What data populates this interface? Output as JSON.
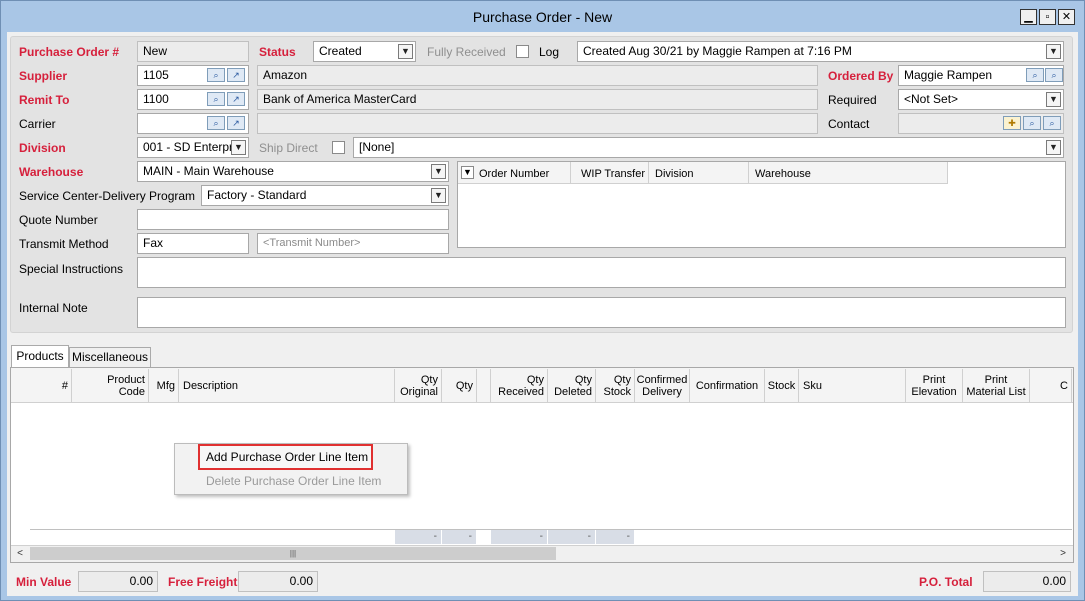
{
  "window": {
    "title": "Purchase Order - New",
    "minimize_glyph": "▁",
    "maximize_glyph": "▫",
    "close_glyph": "✕"
  },
  "header": {
    "po_label": "Purchase Order #",
    "po_value": "New",
    "status_label": "Status",
    "status_value": "Created",
    "fully_received_label": "Fully Received",
    "log_label": "Log",
    "log_value": "Created Aug 30/21 by Maggie Rampen at 7:16 PM",
    "supplier_label": "Supplier",
    "supplier_code": "1105",
    "supplier_name": "Amazon",
    "ordered_by_label": "Ordered By",
    "ordered_by_value": "Maggie Rampen",
    "remit_label": "Remit To",
    "remit_code": "1100",
    "remit_name": "Bank of America MasterCard",
    "required_label": "Required",
    "required_value": "<Not Set>",
    "carrier_label": "Carrier",
    "carrier_value": "",
    "contact_label": "Contact",
    "division_label": "Division",
    "division_value": "001 - SD Enterpr",
    "ship_direct_label": "Ship Direct",
    "ship_direct_value": "[None]",
    "warehouse_label": "Warehouse",
    "warehouse_value": "MAIN - Main Warehouse",
    "service_label": "Service Center-Delivery Program",
    "service_value": "Factory - Standard",
    "quote_label": "Quote Number",
    "quote_value": "",
    "transmit_label": "Transmit Method",
    "transmit_value": "Fax",
    "transmit_number_placeholder": "<Transmit Number>",
    "special_label": "Special Instructions",
    "internal_label": "Internal Note"
  },
  "order_grid": {
    "columns": [
      "Order Number",
      "WIP Transfer",
      "Division",
      "Warehouse"
    ]
  },
  "tabs": [
    "Products",
    "Miscellaneous"
  ],
  "products_grid": {
    "columns": [
      {
        "l1": "",
        "l2": "#"
      },
      {
        "l1": "Product",
        "l2": "Code"
      },
      {
        "l1": "",
        "l2": "Mfg"
      },
      {
        "l1": "",
        "l2": "Description"
      },
      {
        "l1": "Qty",
        "l2": "Original"
      },
      {
        "l1": "",
        "l2": "Qty"
      },
      {
        "l1": "Qty",
        "l2": "Received"
      },
      {
        "l1": "Qty",
        "l2": "Deleted"
      },
      {
        "l1": "Qty",
        "l2": "Stock"
      },
      {
        "l1": "Confirmed",
        "l2": "Delivery"
      },
      {
        "l1": "",
        "l2": "Confirmation"
      },
      {
        "l1": "",
        "l2": "Stock"
      },
      {
        "l1": "",
        "l2": "Sku"
      },
      {
        "l1": "Print",
        "l2": "Elevation"
      },
      {
        "l1": "Print",
        "l2": "Material List"
      },
      {
        "l1": "",
        "l2": "C"
      }
    ],
    "summary": [
      "-",
      "-",
      "-",
      "-",
      "-"
    ]
  },
  "context_menu": {
    "add": "Add Purchase Order Line Item",
    "delete": "Delete Purchase Order Line Item"
  },
  "footer": {
    "min_value_label": "Min Value",
    "min_value": "0.00",
    "free_freight_label": "Free Freight",
    "free_freight": "0.00",
    "po_total_label": "P.O. Total",
    "po_total": "0.00"
  },
  "icons": {
    "dropdown": "▼",
    "search": "⌕",
    "link": "↗",
    "new_contact": "✚",
    "scroll_left": "<",
    "scroll_right": ">",
    "scroll_grip": "|||"
  },
  "colors": {
    "required_label": "#d6203c",
    "title_bar": "#a9c6e6",
    "menu_highlight_border": "#e03030"
  }
}
